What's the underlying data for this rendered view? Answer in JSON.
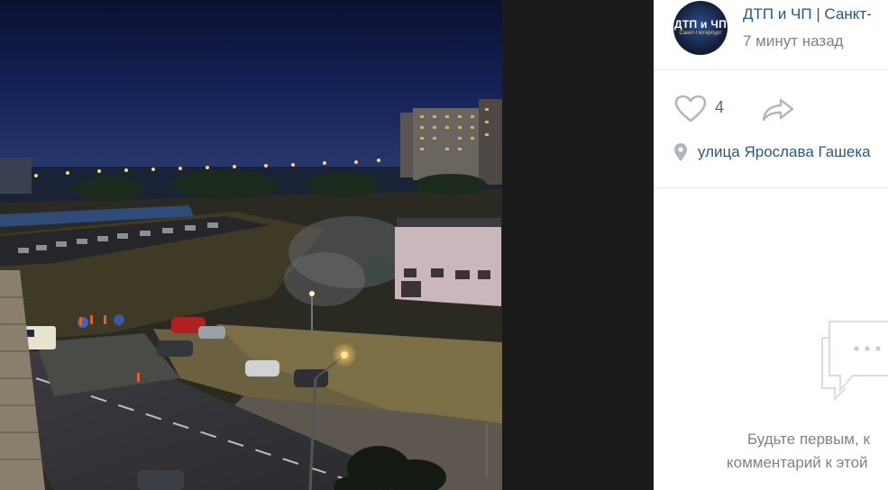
{
  "post": {
    "avatar_title": "ДТП и ЧП",
    "avatar_subtitle": "Санкт-Петербург",
    "author": "ДТП и ЧП | Санкт-",
    "time": "7 минут назад",
    "likes": "4",
    "location": "улица Ярослава Гашека"
  },
  "comments": {
    "empty_line1": "Будьте первым, к",
    "empty_line2": "комментарий к этой"
  },
  "icons": {
    "like": "heart-outline-icon",
    "share": "share-arrow-icon",
    "location": "map-pin-icon",
    "comments": "chat-bubble-icon"
  },
  "colors": {
    "link": "#2a5885",
    "muted": "#828282",
    "icon": "#aeb7c2",
    "sky": "#0b1233"
  }
}
